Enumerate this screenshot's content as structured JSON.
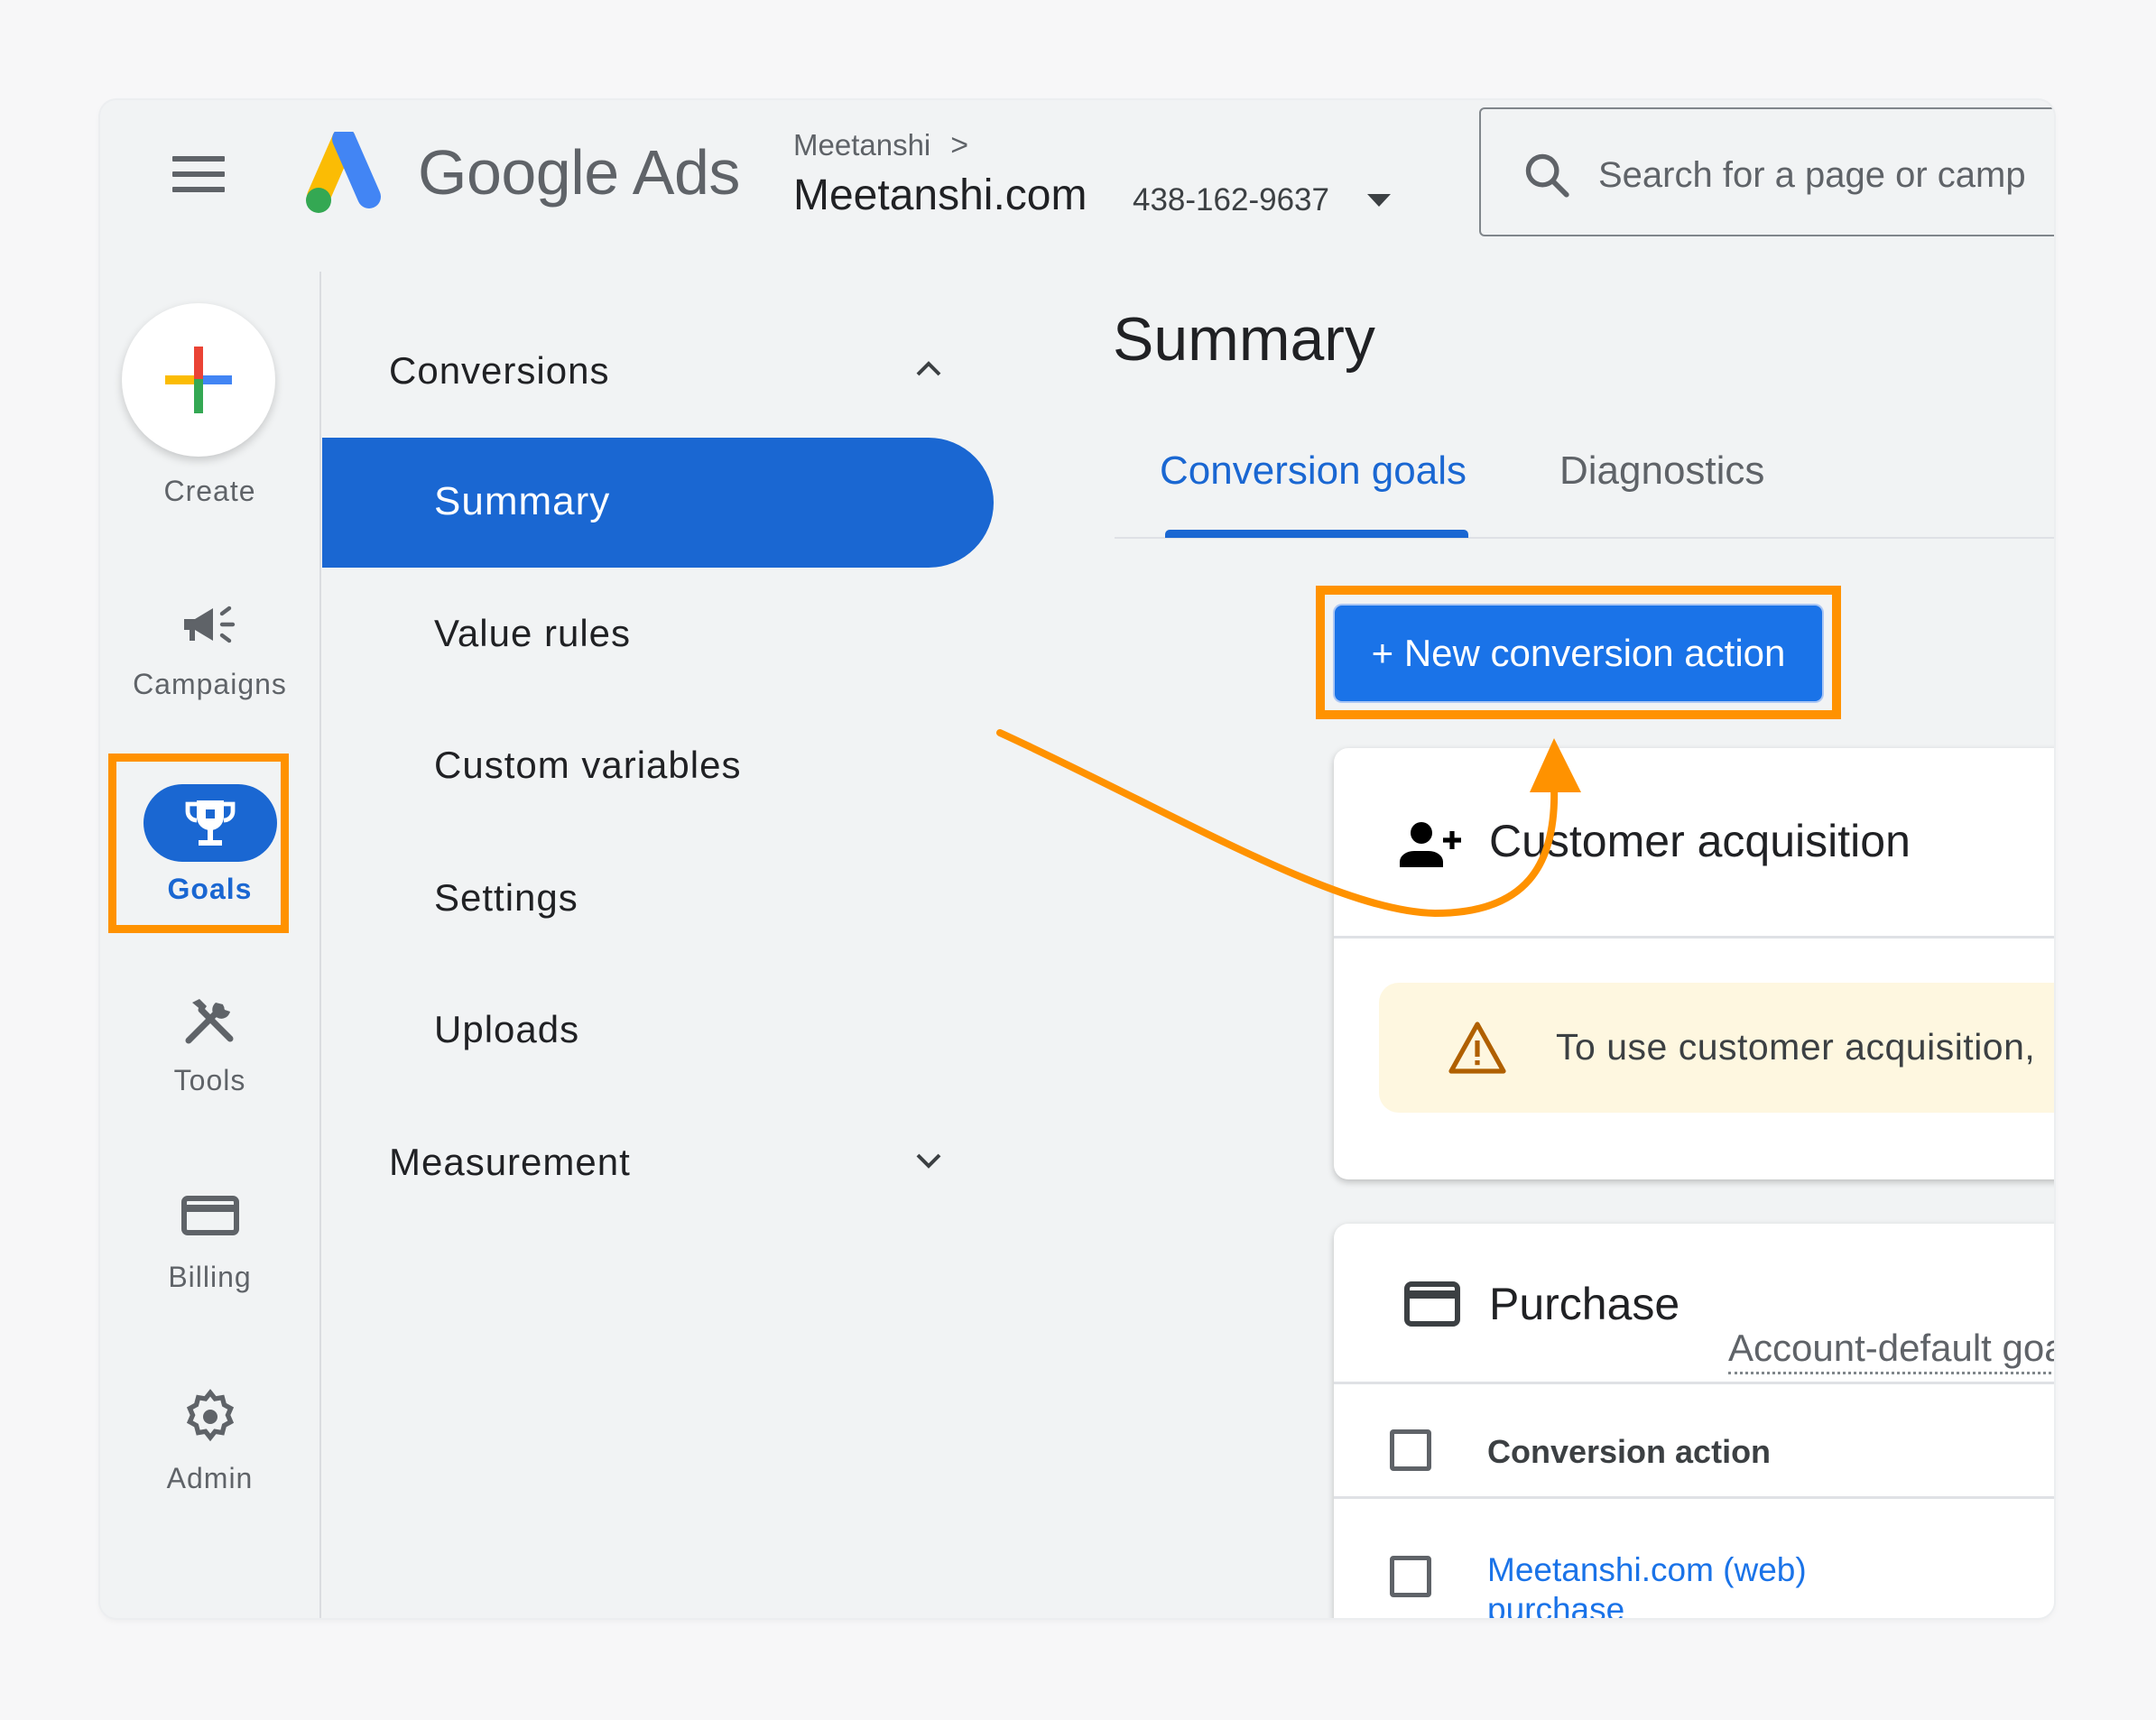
{
  "header": {
    "menu_icon": "hamburger-menu-icon",
    "brand": "Google Ads",
    "breadcrumb_parent": "Meetanshi",
    "breadcrumb_chevron": ">",
    "account_name": "Meetanshi.com",
    "account_id": "438-162-9637",
    "search_placeholder": "Search for a page or camp"
  },
  "rail": {
    "items": [
      {
        "label": "Create",
        "icon": "create-plus-icon"
      },
      {
        "label": "Campaigns",
        "icon": "megaphone-icon"
      },
      {
        "label": "Goals",
        "icon": "trophy-icon",
        "active": true
      },
      {
        "label": "Tools",
        "icon": "tools-icon"
      },
      {
        "label": "Billing",
        "icon": "credit-card-icon"
      },
      {
        "label": "Admin",
        "icon": "gear-icon"
      }
    ]
  },
  "submenu": {
    "sections": [
      {
        "label": "Conversions",
        "expanded": true,
        "items": [
          "Summary",
          "Value rules",
          "Custom variables",
          "Settings",
          "Uploads"
        ],
        "active": "Summary"
      },
      {
        "label": "Measurement",
        "expanded": false
      }
    ]
  },
  "main": {
    "title": "Summary",
    "tabs": [
      {
        "label": "Conversion goals",
        "active": true
      },
      {
        "label": "Diagnostics",
        "active": false
      }
    ],
    "new_action_button": "+ New conversion action",
    "cards": {
      "customer_acquisition": {
        "title": "Customer acquisition",
        "warning": "To use customer acquisition,"
      },
      "purchase": {
        "title": "Purchase",
        "badge": "Account-default goal",
        "column_header": "Conversion action",
        "rows": [
          {
            "line1": "Meetanshi.com (web)",
            "line2": "purchase"
          }
        ]
      }
    }
  },
  "annotation": {
    "highlight_color": "#ff9200",
    "arrow": "curved arrow from submenu to New conversion action button"
  },
  "colors": {
    "accent_blue": "#1a67d2",
    "button_blue": "#1a73e8",
    "warning_bg": "#fef7e0",
    "warning_icon": "#b06000"
  }
}
